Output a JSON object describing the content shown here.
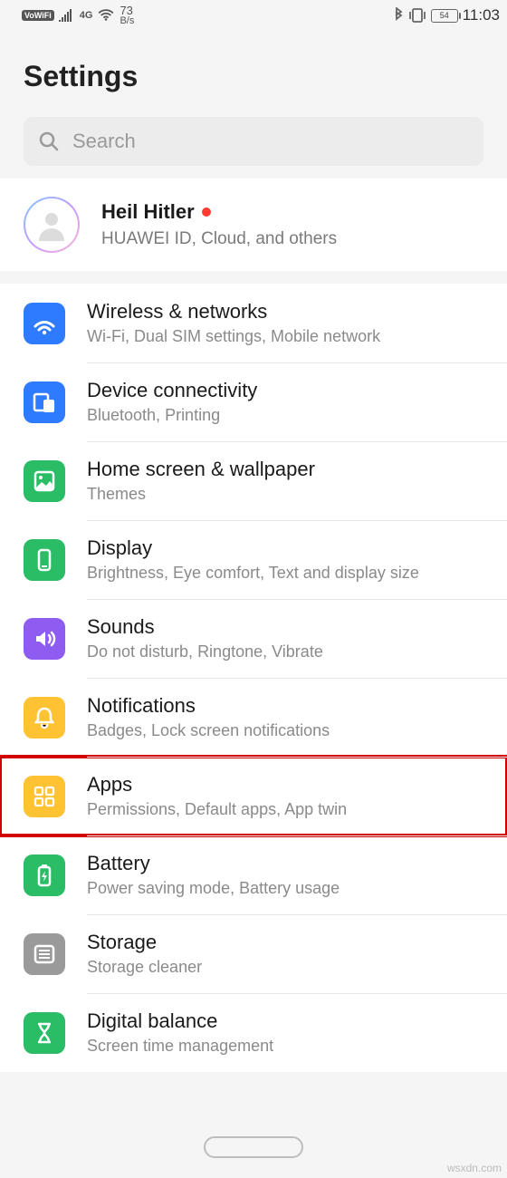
{
  "statusbar": {
    "vowifi": "VoWiFi",
    "network_gen": "4G",
    "speed_value": "73",
    "speed_unit": "B/s",
    "battery_text": "54",
    "clock": "11:03"
  },
  "header": {
    "title": "Settings"
  },
  "search": {
    "placeholder": "Search"
  },
  "account": {
    "name": "Heil Hitler",
    "subtitle": "HUAWEI ID, Cloud, and others"
  },
  "items": [
    {
      "icon": "wifi-icon",
      "color": "#2f7bff",
      "title": "Wireless & networks",
      "sub": "Wi-Fi, Dual SIM settings, Mobile network"
    },
    {
      "icon": "devices-icon",
      "color": "#2f7bff",
      "title": "Device connectivity",
      "sub": "Bluetooth, Printing"
    },
    {
      "icon": "wallpaper-icon",
      "color": "#2bbd66",
      "title": "Home screen & wallpaper",
      "sub": "Themes"
    },
    {
      "icon": "display-icon",
      "color": "#2bbd66",
      "title": "Display",
      "sub": "Brightness, Eye comfort, Text and display size"
    },
    {
      "icon": "sounds-icon",
      "color": "#8e5cf0",
      "title": "Sounds",
      "sub": "Do not disturb, Ringtone, Vibrate"
    },
    {
      "icon": "bell-icon",
      "color": "#ffc233",
      "title": "Notifications",
      "sub": "Badges, Lock screen notifications"
    },
    {
      "icon": "apps-icon",
      "color": "#ffc233",
      "title": "Apps",
      "sub": "Permissions, Default apps, App twin",
      "highlight": true
    },
    {
      "icon": "battery-icon",
      "color": "#2bbd66",
      "title": "Battery",
      "sub": "Power saving mode, Battery usage"
    },
    {
      "icon": "storage-icon",
      "color": "#9a9a9a",
      "title": "Storage",
      "sub": "Storage cleaner"
    },
    {
      "icon": "hourglass-icon",
      "color": "#2bbd66",
      "title": "Digital balance",
      "sub": "Screen time management"
    }
  ],
  "watermark": "wsxdn.com"
}
